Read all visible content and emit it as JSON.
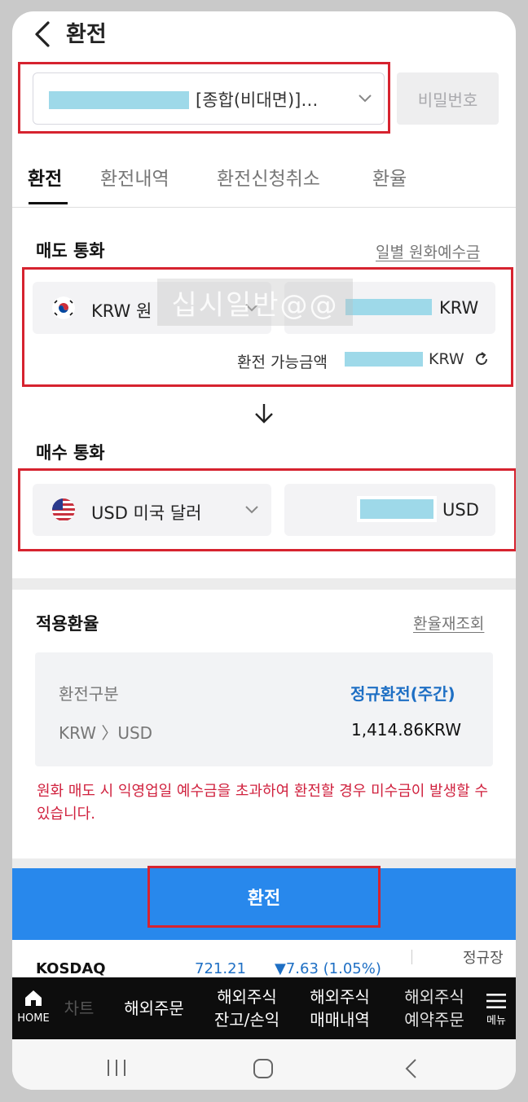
{
  "header": {
    "title": "환전"
  },
  "account": {
    "name_suffix": "[종합(비대면)]…",
    "password_label": "비밀번호"
  },
  "tabs": [
    {
      "label": "환전",
      "active": true
    },
    {
      "label": "환전내역"
    },
    {
      "label": "환전신청취소"
    },
    {
      "label": "환율"
    }
  ],
  "sell": {
    "title": "매도 통화",
    "link": "일별 원화예수금",
    "currency_label": "KRW 원",
    "amount_unit": "KRW",
    "available_label": "환전 가능금액",
    "available_unit": "KRW",
    "watermark": "십시일반@@"
  },
  "buy": {
    "title": "매수 통화",
    "currency_label": "USD 미국 달러",
    "amount_unit": "USD"
  },
  "rate": {
    "title": "적용환율",
    "link": "환율재조회",
    "type_label": "환전구분",
    "type_value": "정규환전(주간)",
    "pair_label": "KRW 〉USD",
    "pair_value": "1,414.86KRW"
  },
  "warning": "원화 매도 시 익영업일 예수금을 초과하여 환전할 경우 미수금이 발생할 수 있습니다.",
  "action": {
    "label": "환전"
  },
  "ticker": {
    "name": "KOSDAQ",
    "value": "721.21",
    "change": "▼7.63 (1.05%)",
    "session": "정규장"
  },
  "bottom_nav": {
    "home": "HOME",
    "partial": "차트",
    "items": [
      "해외주문",
      "해외주식\n잔고/손익",
      "해외주식\n매매내역",
      "해외주식\n예약주문"
    ],
    "menu": "메뉴"
  },
  "colors": {
    "accent": "#2888ec",
    "highlight": "#d6232f",
    "link_blue": "#1e6fc4",
    "warning": "#d0213e"
  }
}
